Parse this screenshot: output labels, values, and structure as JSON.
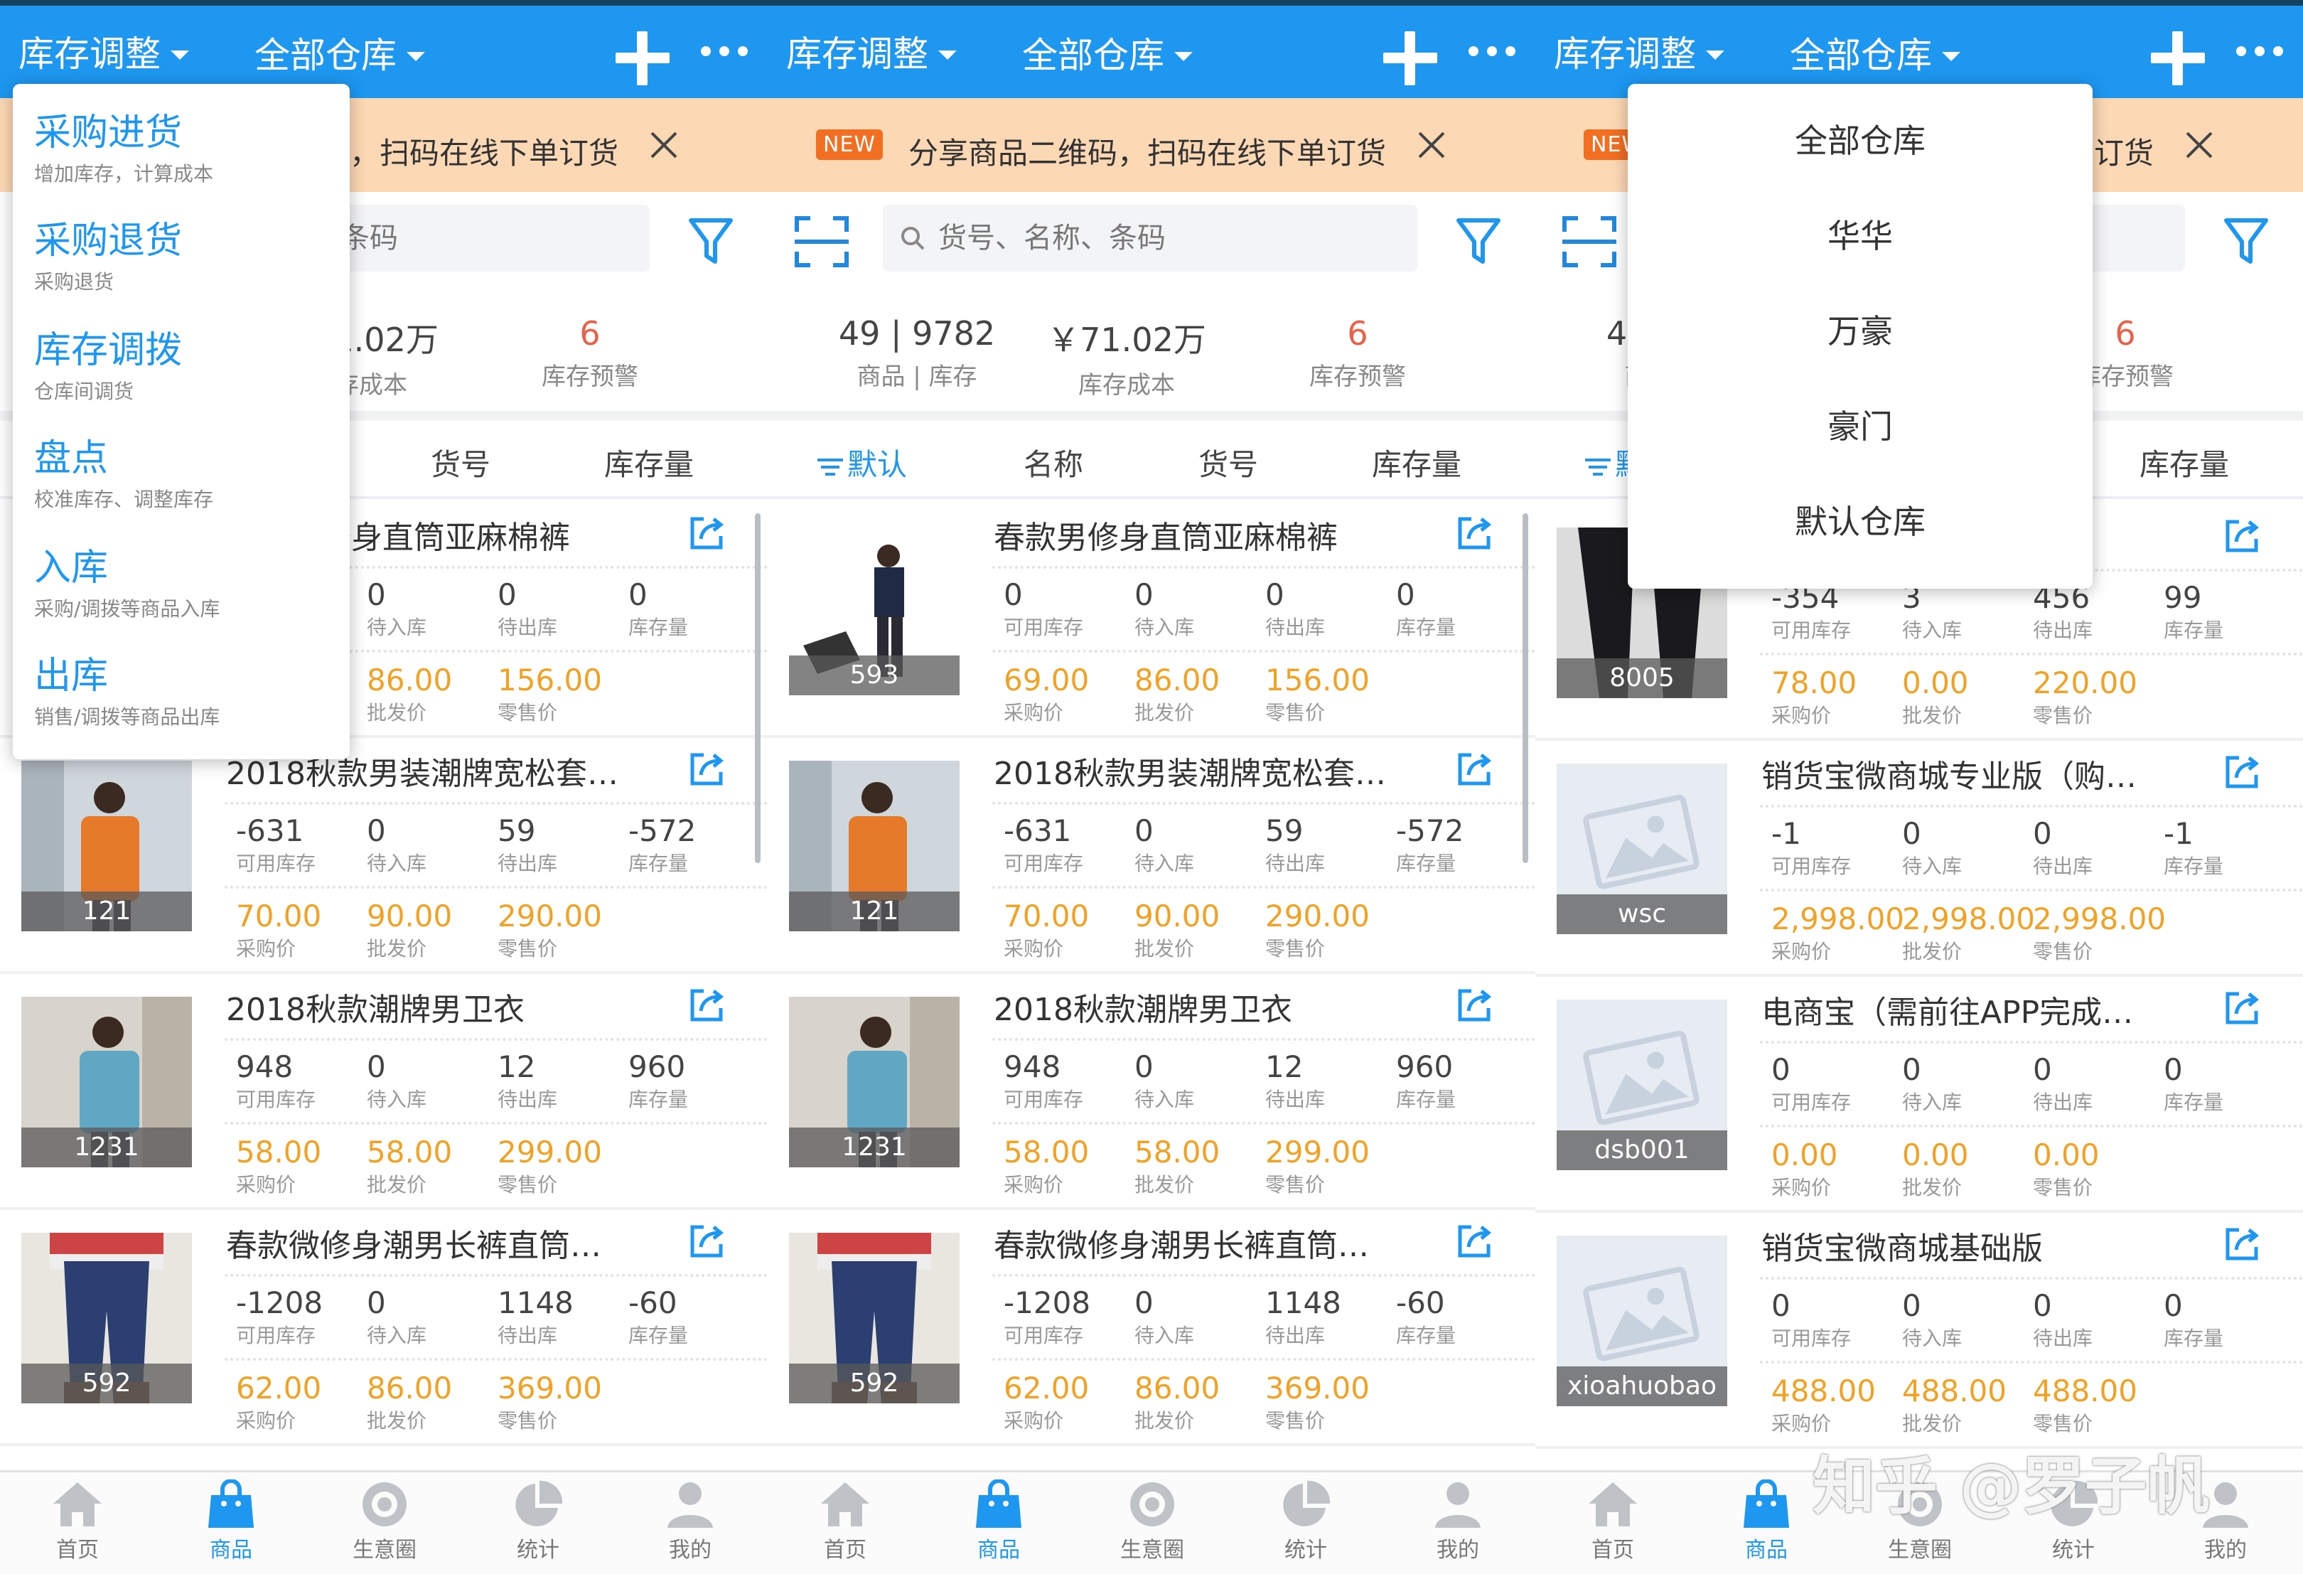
{
  "header": {
    "title": "库存调整",
    "warehouse": "全部仓库"
  },
  "banner": {
    "badge": "NEW",
    "text": "分享商品二维码，扫码在线下单订货"
  },
  "search": {
    "placeholder": "货号、名称、条码"
  },
  "stats": {
    "count": "49 | 9782",
    "count_label": "商品 | 库存",
    "cost": "￥71.02万",
    "cost_label": "库存成本",
    "warn": "6",
    "warn_label": "库存预警"
  },
  "sort_tabs": [
    "默认",
    "名称",
    "货号",
    "库存量"
  ],
  "labels": {
    "avail": "可用库存",
    "in": "待入库",
    "out": "待出库",
    "stock": "库存量",
    "buy": "采购价",
    "wholesale": "批发价",
    "retail": "零售价"
  },
  "products_a": [
    {
      "title": "春款男修身直筒亚麻棉裤",
      "code": "593",
      "avail": "0",
      "in": "0",
      "out": "0",
      "stock": "0",
      "buy": "69.00",
      "wholesale": "86.00",
      "retail": "156.00"
    },
    {
      "title": "2018秋款男装潮牌宽松套…",
      "code": "121",
      "avail": "-631",
      "in": "0",
      "out": "59",
      "stock": "-572",
      "buy": "70.00",
      "wholesale": "90.00",
      "retail": "290.00"
    },
    {
      "title": "2018秋款潮牌男卫衣",
      "code": "1231",
      "avail": "948",
      "in": "0",
      "out": "12",
      "stock": "960",
      "buy": "58.00",
      "wholesale": "58.00",
      "retail": "299.00"
    },
    {
      "title": "春款微修身潮男长裤直筒…",
      "code": "592",
      "avail": "-1208",
      "in": "0",
      "out": "1148",
      "stock": "-60",
      "buy": "62.00",
      "wholesale": "86.00",
      "retail": "369.00"
    }
  ],
  "products_b": [
    {
      "title": "",
      "code": "8005",
      "avail": "-354",
      "in": "3",
      "out": "456",
      "stock": "99",
      "buy": "78.00",
      "wholesale": "0.00",
      "retail": "220.00"
    },
    {
      "title": "销货宝微商城专业版（购…",
      "code": "wsc",
      "avail": "-1",
      "in": "0",
      "out": "0",
      "stock": "-1",
      "buy": "2,998.00",
      "wholesale": "2,998.00",
      "retail": "2,998.00"
    },
    {
      "title": "电商宝（需前往APP完成…",
      "code": "dsb001",
      "avail": "0",
      "in": "0",
      "out": "0",
      "stock": "0",
      "buy": "0.00",
      "wholesale": "0.00",
      "retail": "0.00"
    },
    {
      "title": "销货宝微商城基础版",
      "code": "xioahuobao",
      "avail": "0",
      "in": "0",
      "out": "0",
      "stock": "0",
      "buy": "488.00",
      "wholesale": "488.00",
      "retail": "488.00"
    }
  ],
  "action_menu": [
    {
      "title": "采购进货",
      "sub": "增加库存，计算成本"
    },
    {
      "title": "采购退货",
      "sub": "采购退货"
    },
    {
      "title": "库存调拨",
      "sub": "仓库间调货"
    },
    {
      "title": "盘点",
      "sub": "校准库存、调整库存"
    },
    {
      "title": "入库",
      "sub": "采购/调拨等商品入库"
    },
    {
      "title": "出库",
      "sub": "销售/调拨等商品出库"
    }
  ],
  "warehouse_menu": [
    "全部仓库",
    "华华",
    "万豪",
    "豪门",
    "默认仓库"
  ],
  "nav": [
    "首页",
    "商品",
    "生意圈",
    "统计",
    "我的"
  ],
  "watermark": "知乎 @罗子帆",
  "colors": {
    "primary": "#1d97f0",
    "orange": "#f1a225",
    "red": "#e8624a",
    "banner": "#fcd8b4"
  }
}
